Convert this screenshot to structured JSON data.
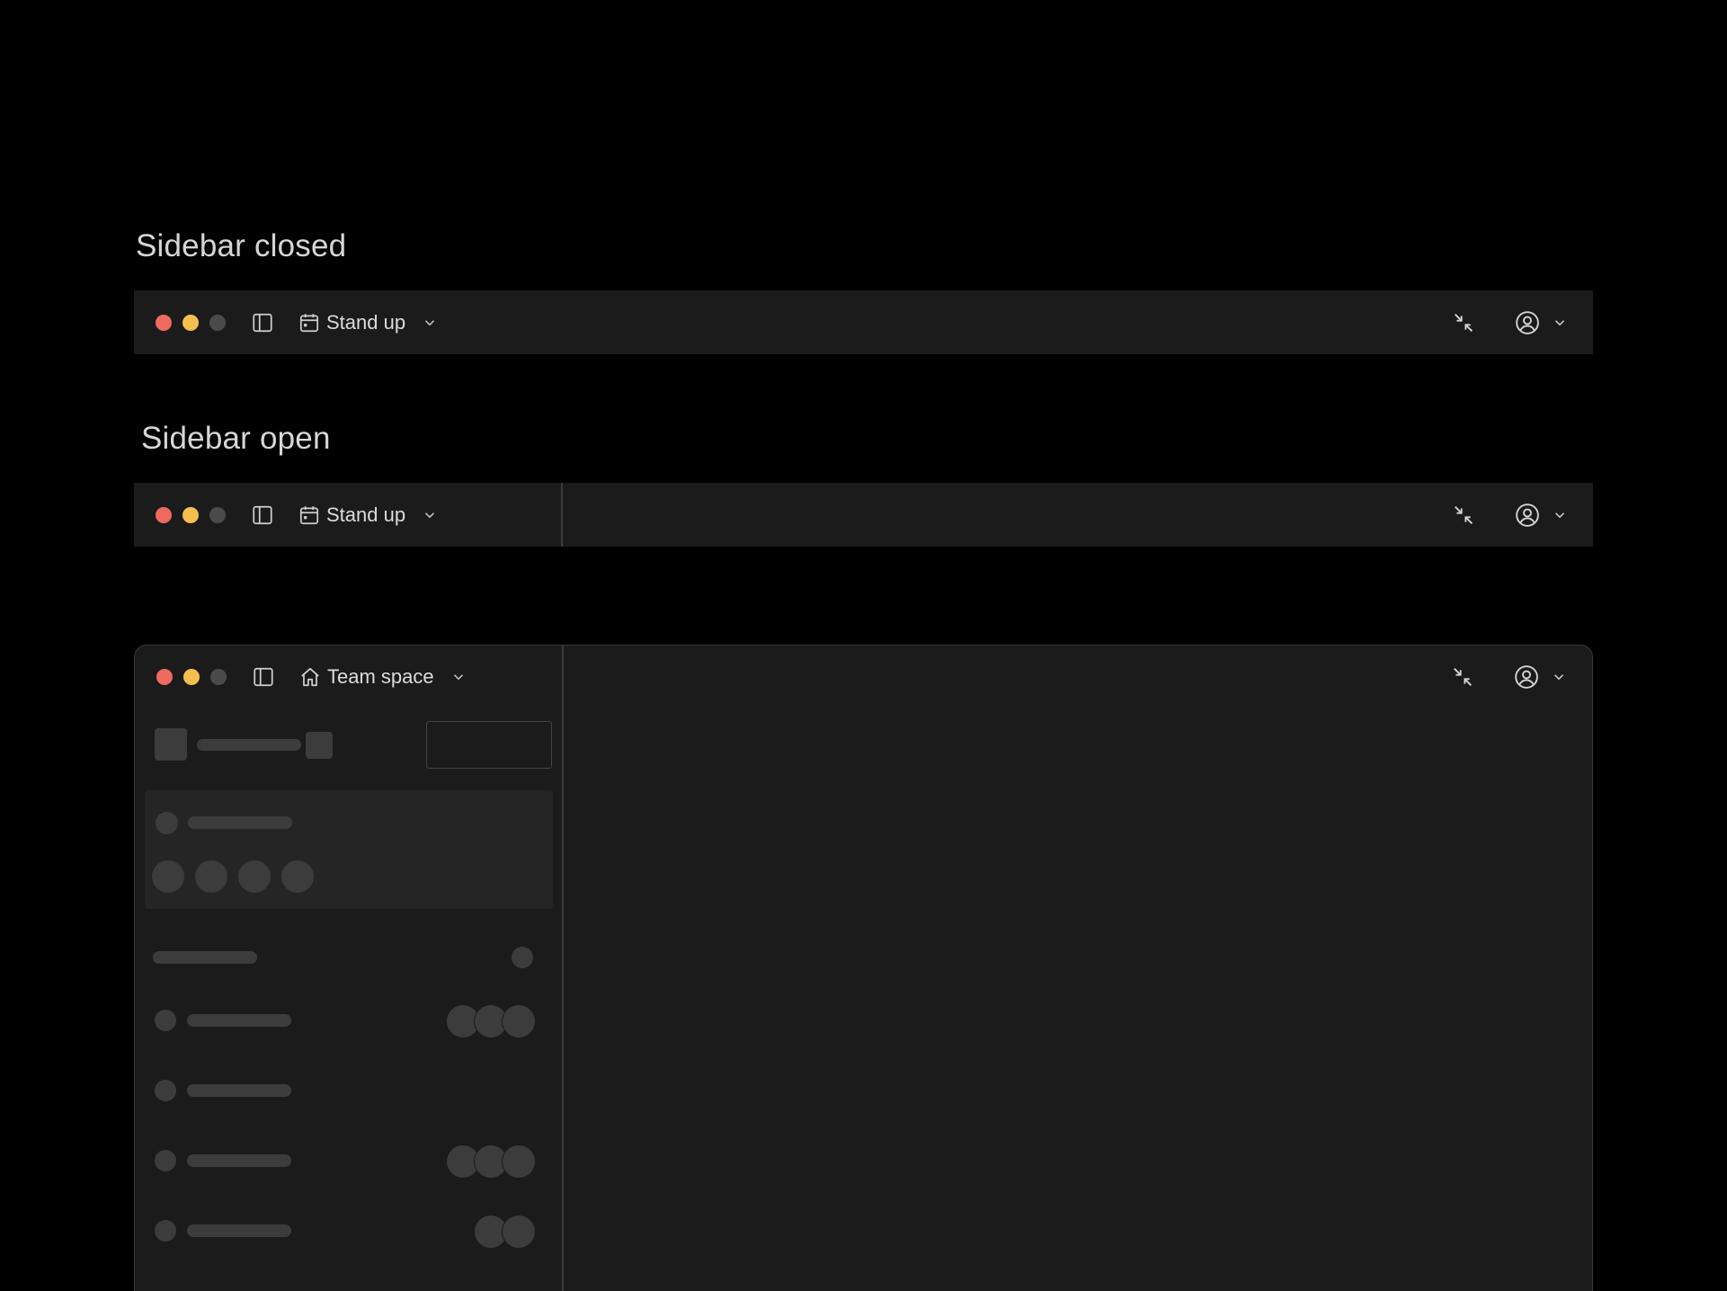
{
  "sections": {
    "closed_title": "Sidebar closed",
    "open_title": "Sidebar open"
  },
  "bar_closed": {
    "breadcrumb": "Stand up"
  },
  "bar_open": {
    "breadcrumb": "Stand up"
  },
  "window": {
    "breadcrumb": "Team space"
  },
  "colors": {
    "close": "#ee6a5e",
    "minimize": "#f5bf4f",
    "zoom_disabled": "#4b4b4b",
    "bar_background": "#1b1b1b",
    "skeleton": "#3c3c3c"
  },
  "icons": {
    "sidebar_toggle": "sidebar-icon",
    "calendar": "calendar-icon",
    "home": "home-icon",
    "chevron": "chevron-down-icon",
    "collapse": "collapse-icon",
    "account": "user-circle-icon"
  }
}
